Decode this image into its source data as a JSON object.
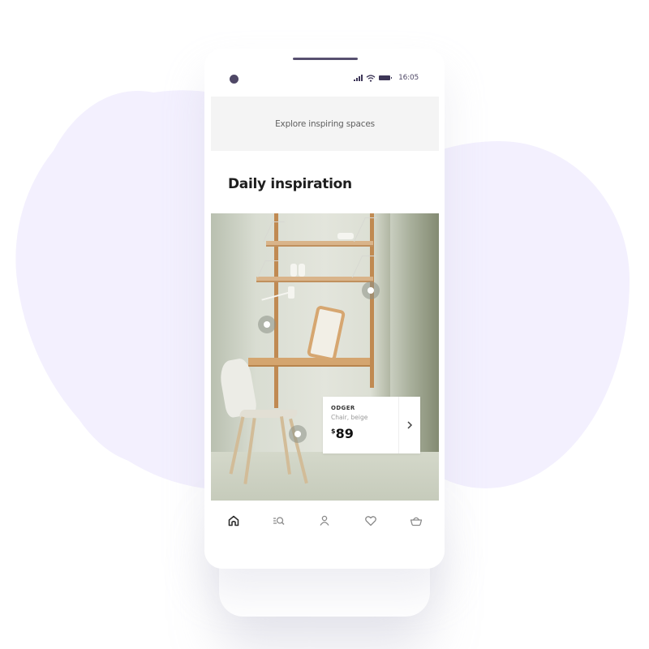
{
  "status_bar": {
    "time": "16:05",
    "icons": [
      "signal-icon",
      "wifi-icon",
      "battery-icon"
    ]
  },
  "header": {
    "explore_label": "Explore inspiring spaces"
  },
  "section": {
    "title": "Daily inspiration"
  },
  "photo": {
    "description": "Wall-mounted wooden shelving unit with desk, mirror, lamp and white chair",
    "hotspots": [
      "shelf-hotspot",
      "lamp-hotspot",
      "chair-hotspot"
    ]
  },
  "product_card": {
    "name": "ODGER",
    "description": "Chair, beige",
    "currency": "$",
    "price": "89",
    "arrow_icon": "chevron-right-icon"
  },
  "bottom_nav": {
    "items": [
      {
        "name": "home",
        "icon": "home-icon",
        "active": true
      },
      {
        "name": "search",
        "icon": "search-list-icon",
        "active": false
      },
      {
        "name": "profile",
        "icon": "user-icon",
        "active": false
      },
      {
        "name": "favorites",
        "icon": "heart-icon",
        "active": false
      },
      {
        "name": "basket",
        "icon": "basket-icon",
        "active": false
      }
    ]
  },
  "colors": {
    "blob": "#f3f0fe",
    "accent_dark": "#4f4866",
    "explore_bg": "#f4f4f4"
  }
}
